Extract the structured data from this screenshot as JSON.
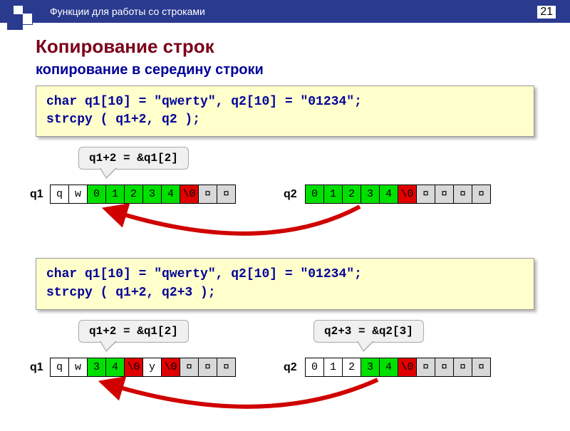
{
  "header": {
    "title": "Функции для работы со строками",
    "page": "21"
  },
  "main": {
    "title": "Копирование строк",
    "subtitle": "копирование в середину строки"
  },
  "code1": {
    "line1": "char q1[10] = \"qwerty\", q2[10] = \"01234\";",
    "line2": "strcpy ( q1+2, q2 );"
  },
  "code2": {
    "line1": "char q1[10] = \"qwerty\", q2[10] = \"01234\";",
    "line2": "strcpy ( q1+2, q2+3 );"
  },
  "hints": {
    "h1": "q1+2 = &q1[2]",
    "h2": "q1+2 = &q1[2]",
    "h3": "q2+3 = &q2[3]"
  },
  "labels": {
    "q1": "q1",
    "q2": "q2"
  },
  "diagram1": {
    "q1": [
      "q",
      "w",
      "0",
      "1",
      "2",
      "3",
      "4",
      "\\0",
      "¤",
      "¤"
    ],
    "q1colors": [
      "white",
      "white",
      "green",
      "green",
      "green",
      "green",
      "green",
      "red",
      "gray",
      "gray"
    ],
    "q2": [
      "0",
      "1",
      "2",
      "3",
      "4",
      "\\0",
      "¤",
      "¤",
      "¤",
      "¤"
    ],
    "q2colors": [
      "green",
      "green",
      "green",
      "green",
      "green",
      "red",
      "gray",
      "gray",
      "gray",
      "gray"
    ]
  },
  "diagram2": {
    "q1": [
      "q",
      "w",
      "3",
      "4",
      "\\0",
      "y",
      "\\0",
      "¤",
      "¤",
      "¤"
    ],
    "q1colors": [
      "white",
      "white",
      "green",
      "green",
      "red",
      "white",
      "red",
      "gray",
      "gray",
      "gray"
    ],
    "q2": [
      "0",
      "1",
      "2",
      "3",
      "4",
      "\\0",
      "¤",
      "¤",
      "¤",
      "¤"
    ],
    "q2colors": [
      "white",
      "white",
      "white",
      "green",
      "green",
      "red",
      "gray",
      "gray",
      "gray",
      "gray"
    ]
  }
}
